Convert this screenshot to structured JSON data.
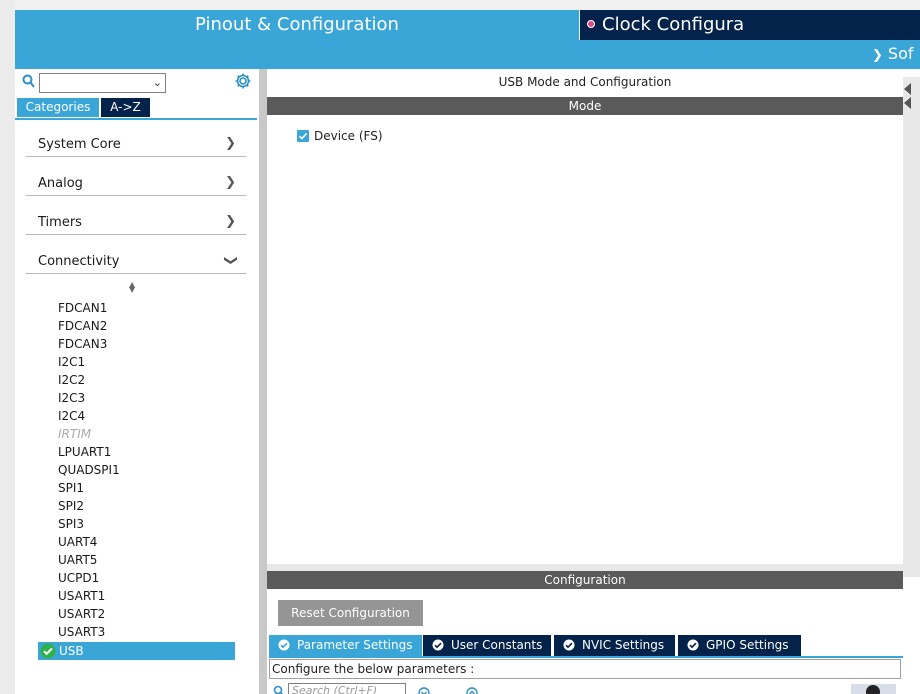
{
  "header": {
    "pinout_tab": "Pinout & Configuration",
    "clock_tab": "Clock Configura",
    "sub_label": "Sof"
  },
  "left": {
    "search_placeholder": "",
    "tabs": {
      "categories": "Categories",
      "az": "A->Z"
    },
    "categories": [
      {
        "label": "System Core",
        "expanded": false
      },
      {
        "label": "Analog",
        "expanded": false
      },
      {
        "label": "Timers",
        "expanded": false
      },
      {
        "label": "Connectivity",
        "expanded": true
      }
    ],
    "peripherals": [
      {
        "label": "FDCAN1",
        "enabled": true
      },
      {
        "label": "FDCAN2",
        "enabled": true
      },
      {
        "label": "FDCAN3",
        "enabled": true
      },
      {
        "label": "I2C1",
        "enabled": true
      },
      {
        "label": "I2C2",
        "enabled": true
      },
      {
        "label": "I2C3",
        "enabled": true
      },
      {
        "label": "I2C4",
        "enabled": true
      },
      {
        "label": "IRTIM",
        "enabled": false
      },
      {
        "label": "LPUART1",
        "enabled": true
      },
      {
        "label": "QUADSPI1",
        "enabled": true
      },
      {
        "label": "SPI1",
        "enabled": true
      },
      {
        "label": "SPI2",
        "enabled": true
      },
      {
        "label": "SPI3",
        "enabled": true
      },
      {
        "label": "UART4",
        "enabled": true
      },
      {
        "label": "UART5",
        "enabled": true
      },
      {
        "label": "UCPD1",
        "enabled": true
      },
      {
        "label": "USART1",
        "enabled": true
      },
      {
        "label": "USART2",
        "enabled": true
      },
      {
        "label": "USART3",
        "enabled": true
      }
    ],
    "selected": "USB"
  },
  "right": {
    "title": "USB Mode and Configuration",
    "mode_header": "Mode",
    "device_label": "Device (FS)",
    "device_checked": true,
    "config_header": "Configuration",
    "reset_label": "Reset Configuration",
    "tabs": [
      {
        "label": "Parameter Settings",
        "active": true
      },
      {
        "label": "User Constants",
        "active": false
      },
      {
        "label": "NVIC Settings",
        "active": false
      },
      {
        "label": "GPIO Settings",
        "active": false
      }
    ],
    "params_text": "Configure the below parameters :",
    "search_placeholder": "Search (Ctrl+F)"
  },
  "colors": {
    "accent": "#3aa6d8",
    "dark": "#03234b",
    "bar": "#5a5a5a"
  }
}
